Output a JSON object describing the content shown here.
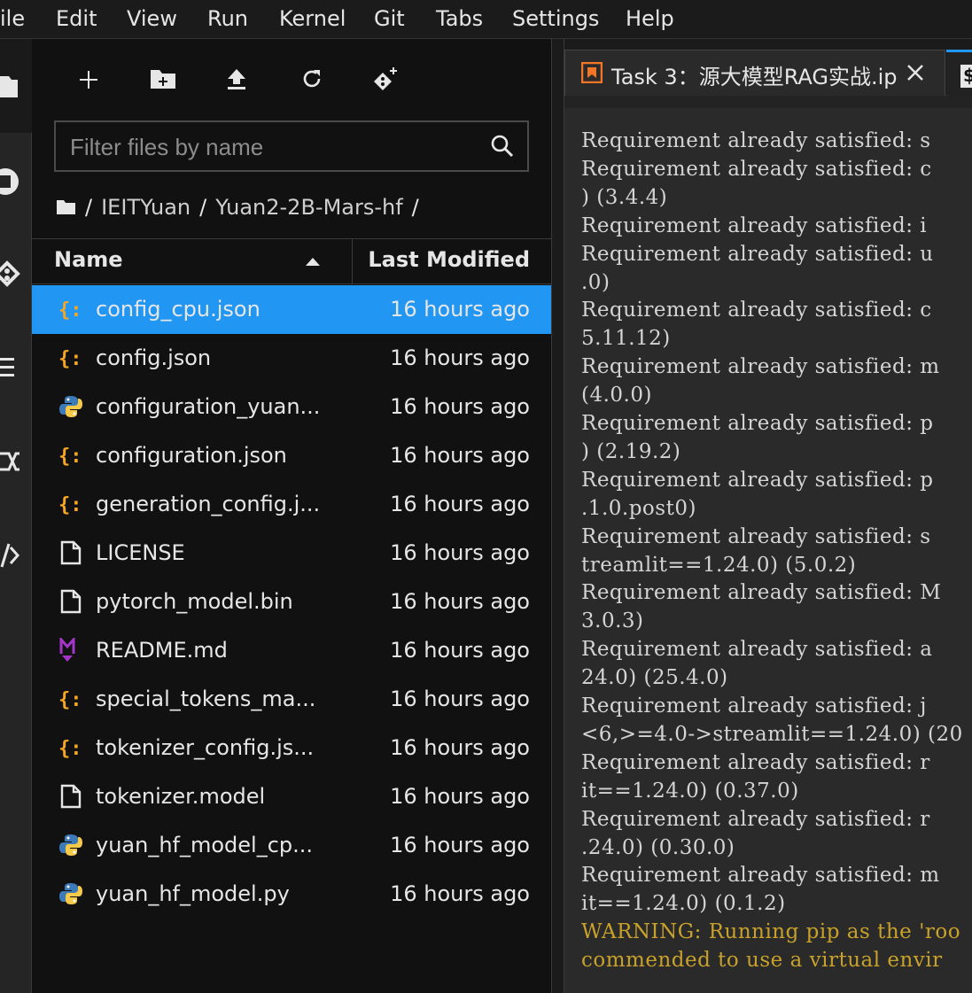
{
  "menu": [
    "ile",
    "Edit",
    "View",
    "Run",
    "Kernel",
    "Git",
    "Tabs",
    "Settings",
    "Help"
  ],
  "filter": {
    "placeholder": "Filter files by name"
  },
  "breadcrumb": {
    "root": "/",
    "parts": [
      "IEITYuan",
      "Yuan2-2B-Mars-hf"
    ],
    "trailing": "/"
  },
  "columns": {
    "name": "Name",
    "modified": "Last Modified"
  },
  "files": [
    {
      "name": "config_cpu.json",
      "modified": "16 hours ago",
      "type": "json",
      "selected": true
    },
    {
      "name": "config.json",
      "modified": "16 hours ago",
      "type": "json"
    },
    {
      "name": "configuration_yuan...",
      "modified": "16 hours ago",
      "type": "python"
    },
    {
      "name": "configuration.json",
      "modified": "16 hours ago",
      "type": "json"
    },
    {
      "name": "generation_config.j...",
      "modified": "16 hours ago",
      "type": "json"
    },
    {
      "name": "LICENSE",
      "modified": "16 hours ago",
      "type": "file"
    },
    {
      "name": "pytorch_model.bin",
      "modified": "16 hours ago",
      "type": "file"
    },
    {
      "name": "README.md",
      "modified": "16 hours ago",
      "type": "markdown"
    },
    {
      "name": "special_tokens_ma...",
      "modified": "16 hours ago",
      "type": "json"
    },
    {
      "name": "tokenizer_config.js...",
      "modified": "16 hours ago",
      "type": "json"
    },
    {
      "name": "tokenizer.model",
      "modified": "16 hours ago",
      "type": "file"
    },
    {
      "name": "yuan_hf_model_cp...",
      "modified": "16 hours ago",
      "type": "python"
    },
    {
      "name": "yuan_hf_model.py",
      "modified": "16 hours ago",
      "type": "python"
    }
  ],
  "tab": {
    "title": "Task 3：源大模型RAG实战.ip",
    "next_glyph": "$"
  },
  "output": [
    {
      "text": "Requirement already satisfied: s"
    },
    {
      "text": "Requirement already satisfied: c"
    },
    {
      "text": ") (3.4.4)"
    },
    {
      "text": "Requirement already satisfied: i"
    },
    {
      "text": "Requirement already satisfied: u"
    },
    {
      "text": ".0)"
    },
    {
      "text": "Requirement already satisfied: c"
    },
    {
      "text": "5.11.12)"
    },
    {
      "text": "Requirement already satisfied: m"
    },
    {
      "text": "(4.0.0)"
    },
    {
      "text": "Requirement already satisfied: p"
    },
    {
      "text": ") (2.19.2)"
    },
    {
      "text": "Requirement already satisfied: p"
    },
    {
      "text": ".1.0.post0)"
    },
    {
      "text": "Requirement already satisfied: s"
    },
    {
      "text": "treamlit==1.24.0) (5.0.2)"
    },
    {
      "text": "Requirement already satisfied: M"
    },
    {
      "text": "3.0.3)"
    },
    {
      "text": "Requirement already satisfied: a"
    },
    {
      "text": "24.0) (25.4.0)"
    },
    {
      "text": "Requirement already satisfied: j"
    },
    {
      "text": "<6,>=4.0->streamlit==1.24.0) (20"
    },
    {
      "text": "Requirement already satisfied: r"
    },
    {
      "text": "it==1.24.0) (0.37.0)"
    },
    {
      "text": "Requirement already satisfied: r"
    },
    {
      "text": ".24.0) (0.30.0)"
    },
    {
      "text": "Requirement already satisfied: m"
    },
    {
      "text": "it==1.24.0) (0.1.2)"
    },
    {
      "text": "WARNING: Running pip as the 'roo",
      "warn": true
    },
    {
      "text": "commended to use a virtual envir",
      "warn": true
    }
  ],
  "colors": {
    "selected_row": "#2196f3",
    "json_icon": "#f5a623",
    "markdown_icon": "#a335c9",
    "warning_text": "#c8a12a",
    "notebook_icon": "#f37626"
  }
}
